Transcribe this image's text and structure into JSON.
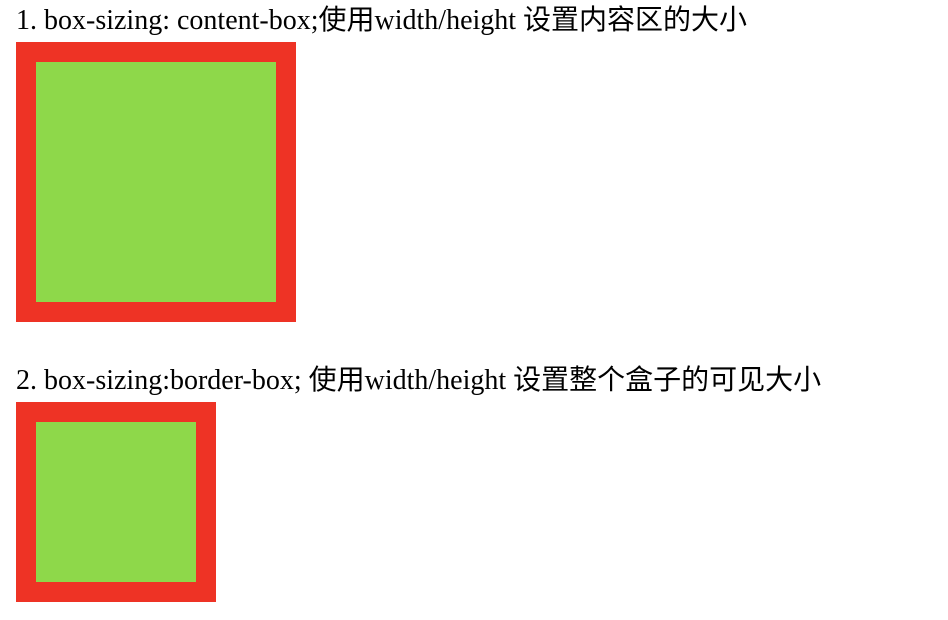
{
  "examples": [
    {
      "heading": "1. box-sizing: content-box;使用width/height 设置内容区的大小",
      "box": {
        "box_sizing": "content-box",
        "border_color": "#EE3325",
        "fill_color": "#8ED84A"
      }
    },
    {
      "heading": "2. box-sizing:border-box; 使用width/height 设置整个盒子的可见大小",
      "box": {
        "box_sizing": "border-box",
        "border_color": "#EE3325",
        "fill_color": "#8ED84A"
      }
    }
  ]
}
